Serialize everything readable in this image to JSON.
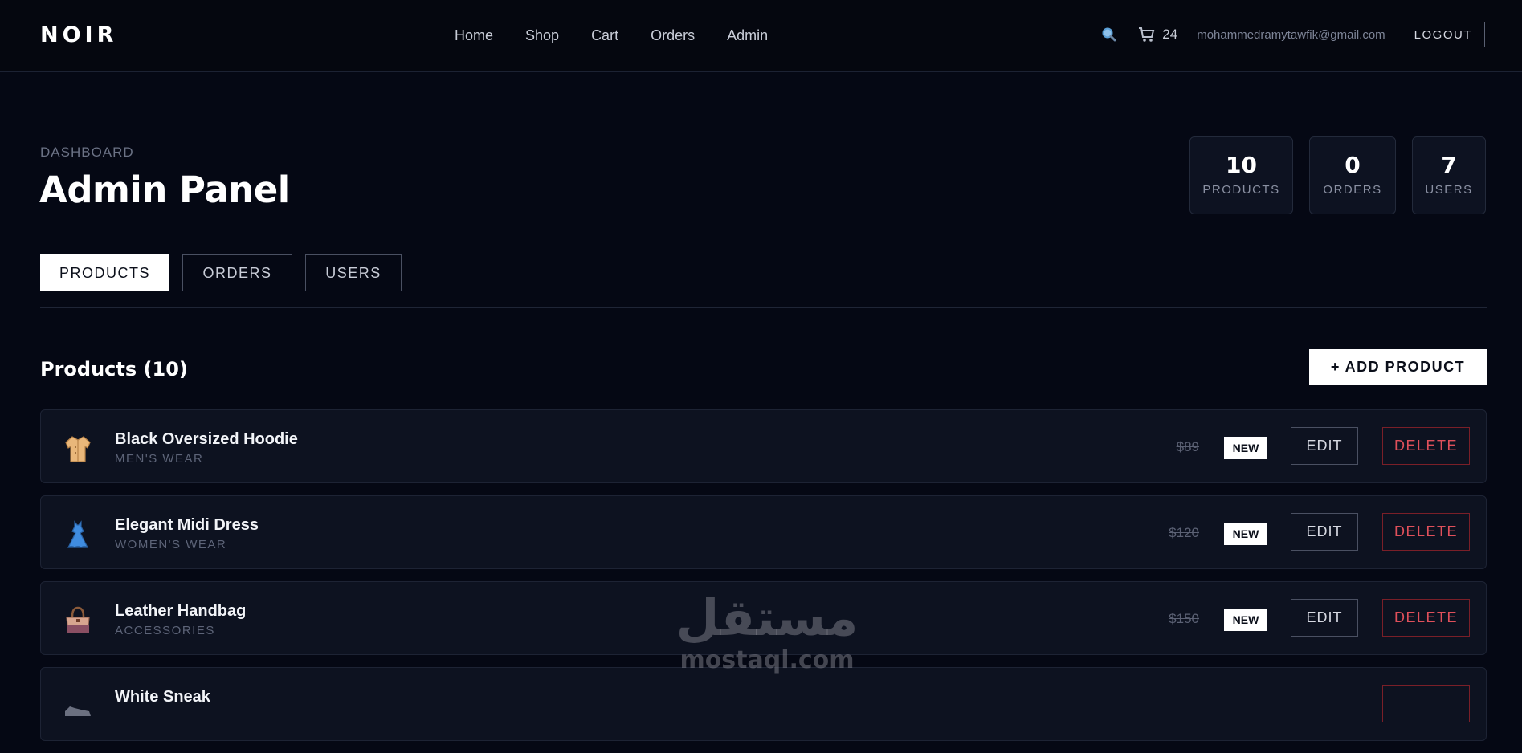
{
  "navbar": {
    "brand": "NOIR",
    "links": [
      "Home",
      "Shop",
      "Cart",
      "Orders",
      "Admin"
    ],
    "cart_count": "24",
    "user_email": "mohammedramytawfik@gmail.com",
    "logout_label": "LOGOUT",
    "icons": {
      "search": "search-icon",
      "cart": "cart-icon"
    }
  },
  "header": {
    "eyebrow": "DASHBOARD",
    "title": "Admin Panel"
  },
  "stats": [
    {
      "value": "10",
      "label": "PRODUCTS"
    },
    {
      "value": "0",
      "label": "ORDERS"
    },
    {
      "value": "7",
      "label": "USERS"
    }
  ],
  "tabs": [
    {
      "label": "PRODUCTS",
      "active": true
    },
    {
      "label": "ORDERS",
      "active": false
    },
    {
      "label": "USERS",
      "active": false
    }
  ],
  "products_section": {
    "title": "Products (10)",
    "add_label": "+ ADD PRODUCT"
  },
  "products": [
    {
      "name": "Black Oversized Hoodie",
      "category": "MEN'S WEAR",
      "price": "$89",
      "badge": "NEW",
      "icon": "coat-icon",
      "edit": "EDIT",
      "delete": "DELETE"
    },
    {
      "name": "Elegant Midi Dress",
      "category": "WOMEN'S WEAR",
      "price": "$120",
      "badge": "NEW",
      "icon": "dress-icon",
      "edit": "EDIT",
      "delete": "DELETE"
    },
    {
      "name": "Leather Handbag",
      "category": "ACCESSORIES",
      "price": "$150",
      "badge": "NEW",
      "icon": "handbag-icon",
      "edit": "EDIT",
      "delete": "DELETE"
    },
    {
      "name": "White Sneak",
      "category": "",
      "price": "",
      "badge": "",
      "icon": "sneaker-icon",
      "edit": "",
      "delete": ""
    }
  ],
  "watermark": {
    "arabic": "مستقل",
    "latin": "mostaql.com"
  },
  "colors": {
    "background": "#050814",
    "card": "#0d1220",
    "danger": "#e0505b",
    "accent_white": "#ffffff"
  }
}
